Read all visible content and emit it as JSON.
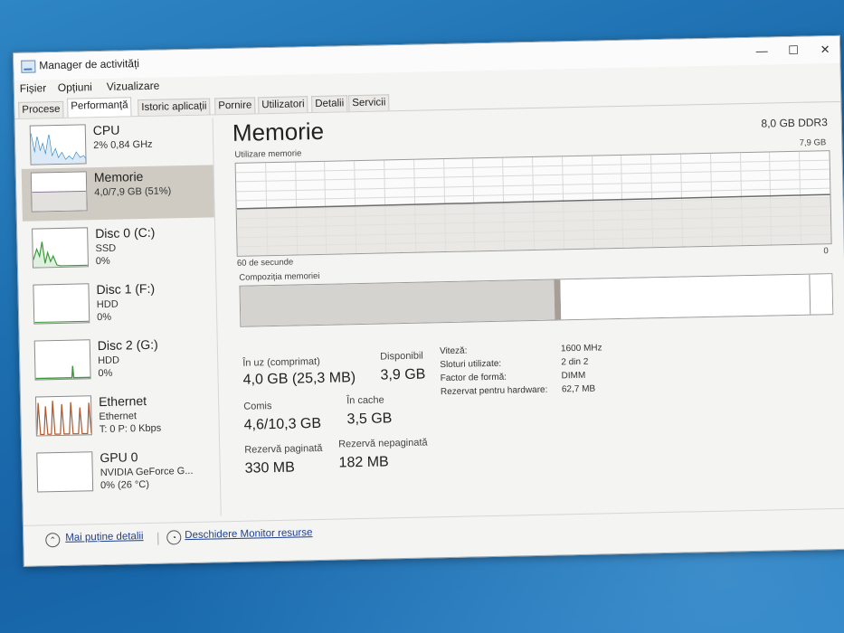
{
  "window": {
    "title": "Manager de activități",
    "minimize": "—",
    "maximize": "☐",
    "close": "✕"
  },
  "menu": [
    "Fișier",
    "Opțiuni",
    "Vizualizare"
  ],
  "tabs": [
    "Procese",
    "Performanță",
    "Istoric aplicații",
    "Pornire",
    "Utilizatori",
    "Detalii",
    "Servicii"
  ],
  "active_tab": "Performanță",
  "sidebar": [
    {
      "title": "CPU",
      "lines": [
        "2% 0,84 GHz"
      ],
      "icon": "cpu-graph"
    },
    {
      "title": "Memorie",
      "lines": [
        "4,0/7,9 GB (51%)"
      ],
      "icon": "memory-graph",
      "selected": true
    },
    {
      "title": "Disc 0 (C:)",
      "lines": [
        "SSD",
        "0%"
      ],
      "icon": "disk-graph"
    },
    {
      "title": "Disc 1 (F:)",
      "lines": [
        "HDD",
        "0%"
      ],
      "icon": "disk-graph"
    },
    {
      "title": "Disc 2 (G:)",
      "lines": [
        "HDD",
        "0%"
      ],
      "icon": "disk-graph"
    },
    {
      "title": "Ethernet",
      "lines": [
        "Ethernet",
        "T: 0 P: 0 Kbps"
      ],
      "icon": "network-graph"
    },
    {
      "title": "GPU 0",
      "lines": [
        "NVIDIA GeForce G...",
        "0% (26 °C)"
      ],
      "icon": "gpu-graph"
    }
  ],
  "main": {
    "title": "Memorie",
    "spec": "8,0 GB DDR3",
    "graph_label": "Utilizare memorie",
    "graph_max": "7,9 GB",
    "graph_time": "60 de secunde",
    "graph_min": "0",
    "usage_level": 0.51,
    "composition_label": "Compoziția memoriei",
    "composition": {
      "in_use": 0.53,
      "modified": 0.01,
      "standby": 0.42,
      "free": 0.04
    },
    "stats": {
      "in_use_label": "În uz (comprimat)",
      "in_use_value": "4,0 GB (25,3 MB)",
      "available_label": "Disponibil",
      "available_value": "3,9 GB",
      "committed_label": "Comis",
      "committed_value": "4,6/10,3 GB",
      "cached_label": "În cache",
      "cached_value": "3,5 GB",
      "paged_label": "Rezervă paginată",
      "paged_value": "330 MB",
      "nonpaged_label": "Rezervă nepaginată",
      "nonpaged_value": "182 MB"
    },
    "details": [
      {
        "key": "Viteză:",
        "value": "1600 MHz"
      },
      {
        "key": "Sloturi utilizate:",
        "value": "2 din 2"
      },
      {
        "key": "Factor de formă:",
        "value": "DIMM"
      },
      {
        "key": "Rezervat pentru hardware:",
        "value": "62,7 MB"
      }
    ]
  },
  "footer": {
    "fewer_details": "Mai puține detalii",
    "resource_monitor": "Deschidere Monitor resurse"
  },
  "colors": {
    "memory_line": "#6b6b6b",
    "memory_fill": "#e3e1de",
    "selected_bg": "#cfcbc3",
    "cpu_line": "#2a7fbf",
    "disk_line": "#3b9a3b",
    "ethernet_line": "#b3562a"
  }
}
